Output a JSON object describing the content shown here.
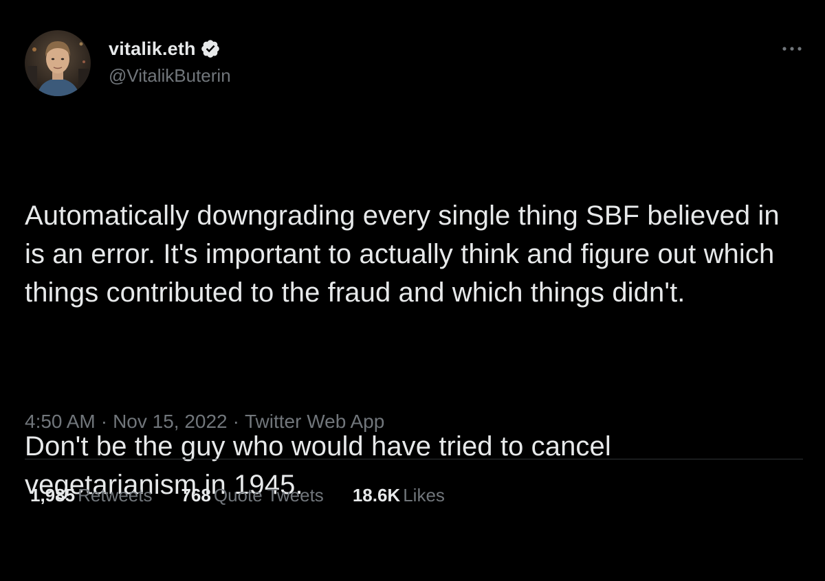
{
  "author": {
    "display_name": "vitalik.eth",
    "handle": "@VitalikButerin",
    "verified_icon": "verified-badge-icon",
    "avatar": "profile-photo"
  },
  "more_menu": {
    "icon": "more-horizontal-icon",
    "glyph": "···"
  },
  "tweet": {
    "paragraphs": [
      "Automatically downgrading every single thing SBF believed in is an error. It's important to actually think and figure out which things contributed to the fraud and which things didn't.",
      "Don't be the guy who would have tried to cancel vegetarianism in 1945."
    ]
  },
  "meta": {
    "time": "4:50 AM",
    "separator": "·",
    "date": "Nov 15, 2022",
    "source": "Twitter Web App"
  },
  "stats": {
    "retweets": {
      "count": "1,985",
      "label": "Retweets"
    },
    "quote_tweets": {
      "count": "768",
      "label": "Quote Tweets"
    },
    "likes": {
      "count": "18.6K",
      "label": "Likes"
    }
  },
  "colors": {
    "background": "#000000",
    "primary_text": "#e7e9ea",
    "secondary_text": "#71767b",
    "divider": "#2f3336"
  }
}
